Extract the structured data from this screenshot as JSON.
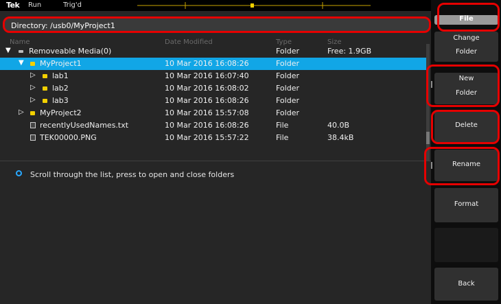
{
  "topbar": {
    "logo": "Tek",
    "run_state": "Run",
    "trigger_state": "Trig'd"
  },
  "directory": {
    "label": "Directory: /usb0/MyProject1"
  },
  "columns": [
    "Name",
    "Date Modified",
    "Type",
    "Size"
  ],
  "files": [
    {
      "name": "Removeable Media(0)",
      "date": "",
      "type": "Folder",
      "size": "Free: 1.9GB",
      "icon": "drive-icon",
      "expand": "expanded"
    },
    {
      "name": "MyProject1",
      "date": "10 Mar 2016 16:08:26",
      "type": "Folder",
      "size": "",
      "icon": "folder-icon",
      "expand": "expanded",
      "selected": true
    },
    {
      "name": "lab1",
      "date": "10 Mar 2016 16:07:40",
      "type": "Folder",
      "size": "",
      "icon": "folder-icon",
      "expand": "collapsed"
    },
    {
      "name": "lab2",
      "date": "10 Mar 2016 16:08:02",
      "type": "Folder",
      "size": "",
      "icon": "folder-icon",
      "expand": "collapsed"
    },
    {
      "name": "lab3",
      "date": "10 Mar 2016 16:08:26",
      "type": "Folder",
      "size": "",
      "icon": "folder-icon",
      "expand": "collapsed"
    },
    {
      "name": "MyProject2",
      "date": "10 Mar 2016 15:57:08",
      "type": "Folder",
      "size": "",
      "icon": "folder-icon",
      "expand": "collapsed"
    },
    {
      "name": "recentlyUsedNames.txt",
      "date": "10 Mar 2016 16:08:26",
      "type": "File",
      "size": "40.0B",
      "icon": "file-icon"
    },
    {
      "name": "TEK00000.PNG",
      "date": "10 Mar 2016 15:57:22",
      "type": "File",
      "size": "38.4kB",
      "icon": "file-icon"
    }
  ],
  "hint": "Scroll through the list, press to open and close folders",
  "sidebar": {
    "file": "File",
    "change_l1": "Change",
    "change_l2": "Folder",
    "new_l1": "New",
    "new_l2": "Folder",
    "delete": "Delete",
    "rename": "Rename",
    "format": "Format",
    "back": "Back"
  },
  "colors": {
    "selection": "#11a6e6",
    "highlight": "#e60000",
    "folder": "#f2d000",
    "knob": "#29a8ff"
  }
}
